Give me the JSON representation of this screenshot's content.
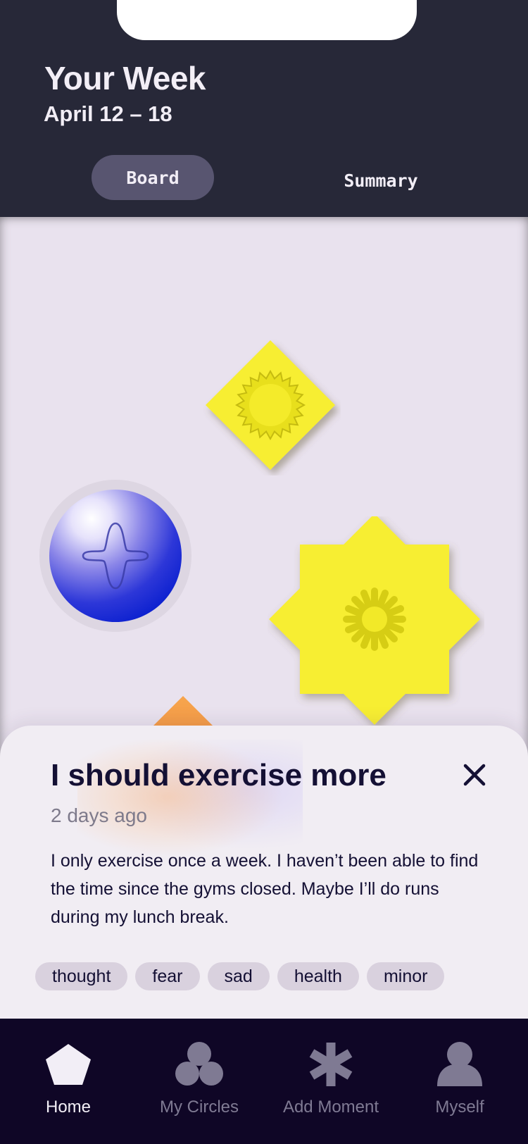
{
  "header": {
    "title": "Your Week",
    "date_range": "April 12 – 18",
    "tabs": [
      {
        "label": "Board",
        "active": true
      },
      {
        "label": "Summary",
        "active": false
      }
    ]
  },
  "board": {
    "moments": [
      {
        "shape": "yellow-diamond-sunburst",
        "color": "#f7ee31"
      },
      {
        "shape": "blue-orb-cross",
        "color": "#0a1fcf"
      },
      {
        "shape": "yellow-star-asterisk",
        "color": "#f7ee31"
      },
      {
        "shape": "orange-diamond",
        "color": "#f5a14a"
      }
    ]
  },
  "detail": {
    "title": "I should exercise more",
    "time_ago": "2 days ago",
    "body": "I only exercise once a week. I haven’t been able to find the time since the gyms closed. Maybe I’ll do runs during my lunch break.",
    "tags": [
      "thought",
      "fear",
      "sad",
      "health",
      "minor"
    ],
    "close_icon": "close-icon"
  },
  "nav": {
    "items": [
      {
        "label": "Home",
        "icon": "pentagon-icon",
        "active": true
      },
      {
        "label": "My Circles",
        "icon": "circles-icon",
        "active": false
      },
      {
        "label": "Add Moment",
        "icon": "asterisk-icon",
        "active": false
      },
      {
        "label": "Myself",
        "icon": "person-icon",
        "active": false
      }
    ]
  },
  "colors": {
    "header_bg": "#272838",
    "board_bg": "#e9e2ee",
    "card_bg": "#f1edf3",
    "tag_bg": "#d9d1de",
    "nav_bg": "#0f0626",
    "accent_yellow": "#f7ee31",
    "accent_blue": "#0a1fcf",
    "text_dark": "#141034"
  }
}
